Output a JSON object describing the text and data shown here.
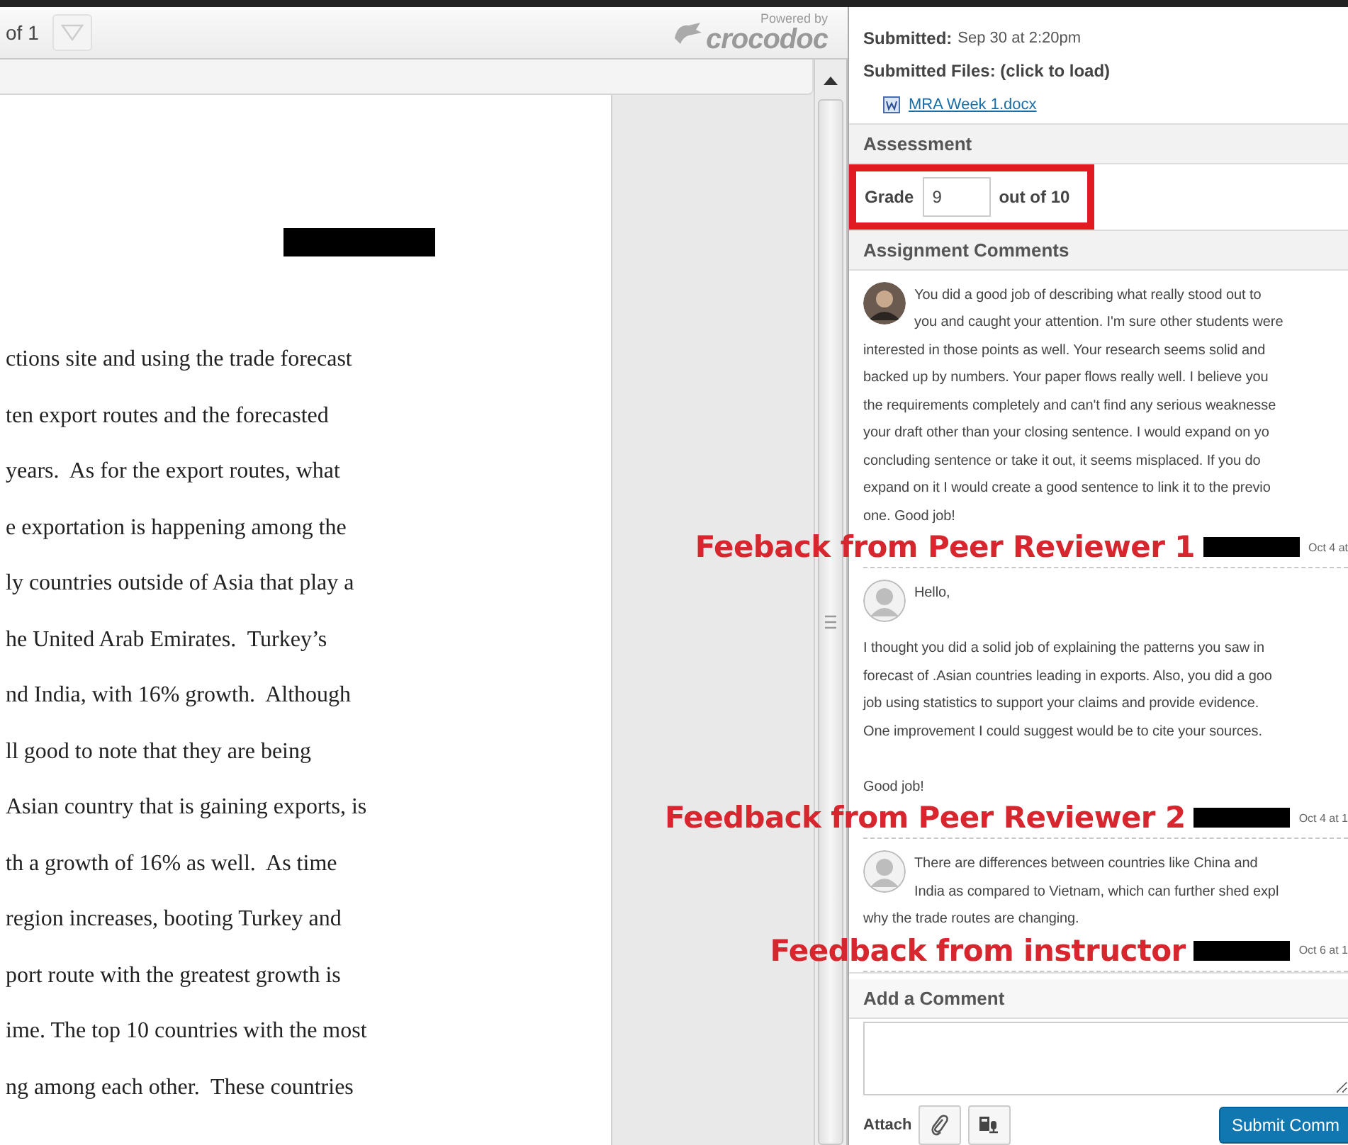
{
  "viewer": {
    "page_count_text": "of 1",
    "powered_by": "Powered by",
    "brand": "crocodoc",
    "heading_redacted": true,
    "lines": [
      "ctions site and using the trade forecast",
      "ten export routes and the forecasted",
      "years.  As for the export routes, what",
      "e exportation is happening among the",
      "ly countries outside of Asia that play a",
      "he United Arab Emirates.  Turkey’s",
      "nd India, with 16% growth.  Although",
      "ll good to note that they are being",
      "Asian country that is gaining exports, is",
      "th a growth of 16% as well.  As time",
      "region increases, booting Turkey and",
      "port route with the greatest growth is",
      "ime. The top 10 countries with the most",
      "ng among each other.  These countries"
    ]
  },
  "submission": {
    "submitted_label": "Submitted:",
    "submitted_value": "Sep 30 at 2:20pm",
    "files_label": "Submitted Files: (click to load)",
    "files": [
      {
        "name": "MRA Week 1.docx"
      }
    ]
  },
  "assessment": {
    "title": "Assessment",
    "grade_label": "Grade",
    "grade_value": "9",
    "grade_suffix": "out of 10",
    "highlighted": true
  },
  "comments_section": {
    "title": "Assignment Comments",
    "comments": [
      {
        "kind": "photo",
        "text": "You did a good job of describing what really stood out to\nyou and caught your attention. I'm sure other students were\ninterested in those points as well. Your research seems solid and\nbacked up by numbers. Your paper flows really well. I believe you\nthe requirements completely and can't find any serious weaknesse\nyour draft other than your closing sentence. I would expand on yo\nconcluding sentence or take it out, it seems misplaced. If you do\nexpand on it I would create a good sentence to link it to the previo\none. Good job!",
        "author_redacted": true,
        "date": "Oct 4 at",
        "annotation": "Feeback from Peer Reviewer 1"
      },
      {
        "kind": "generic",
        "text": "Hello,\n\nI thought you did a solid job of explaining the patterns you saw in\nforecast of .Asian countries leading in exports. Also, you did a goo\njob using statistics to support your claims and provide evidence.\nOne improvement I could suggest would be to cite your sources.\n\nGood job!",
        "author_redacted": true,
        "date": "Oct 4 at 1",
        "annotation": "Feedback from Peer Reviewer 2"
      },
      {
        "kind": "generic",
        "text": "There are differences between countries like China and\nIndia as compared to Vietnam, which can further shed expl\nwhy the trade routes are changing.",
        "author_redacted": true,
        "date": "Oct 6 at 1",
        "annotation": "Feedback from instructor"
      }
    ]
  },
  "add_comment": {
    "title": "Add a Comment",
    "attach_label": "Attach",
    "submit": "Submit Comm"
  }
}
